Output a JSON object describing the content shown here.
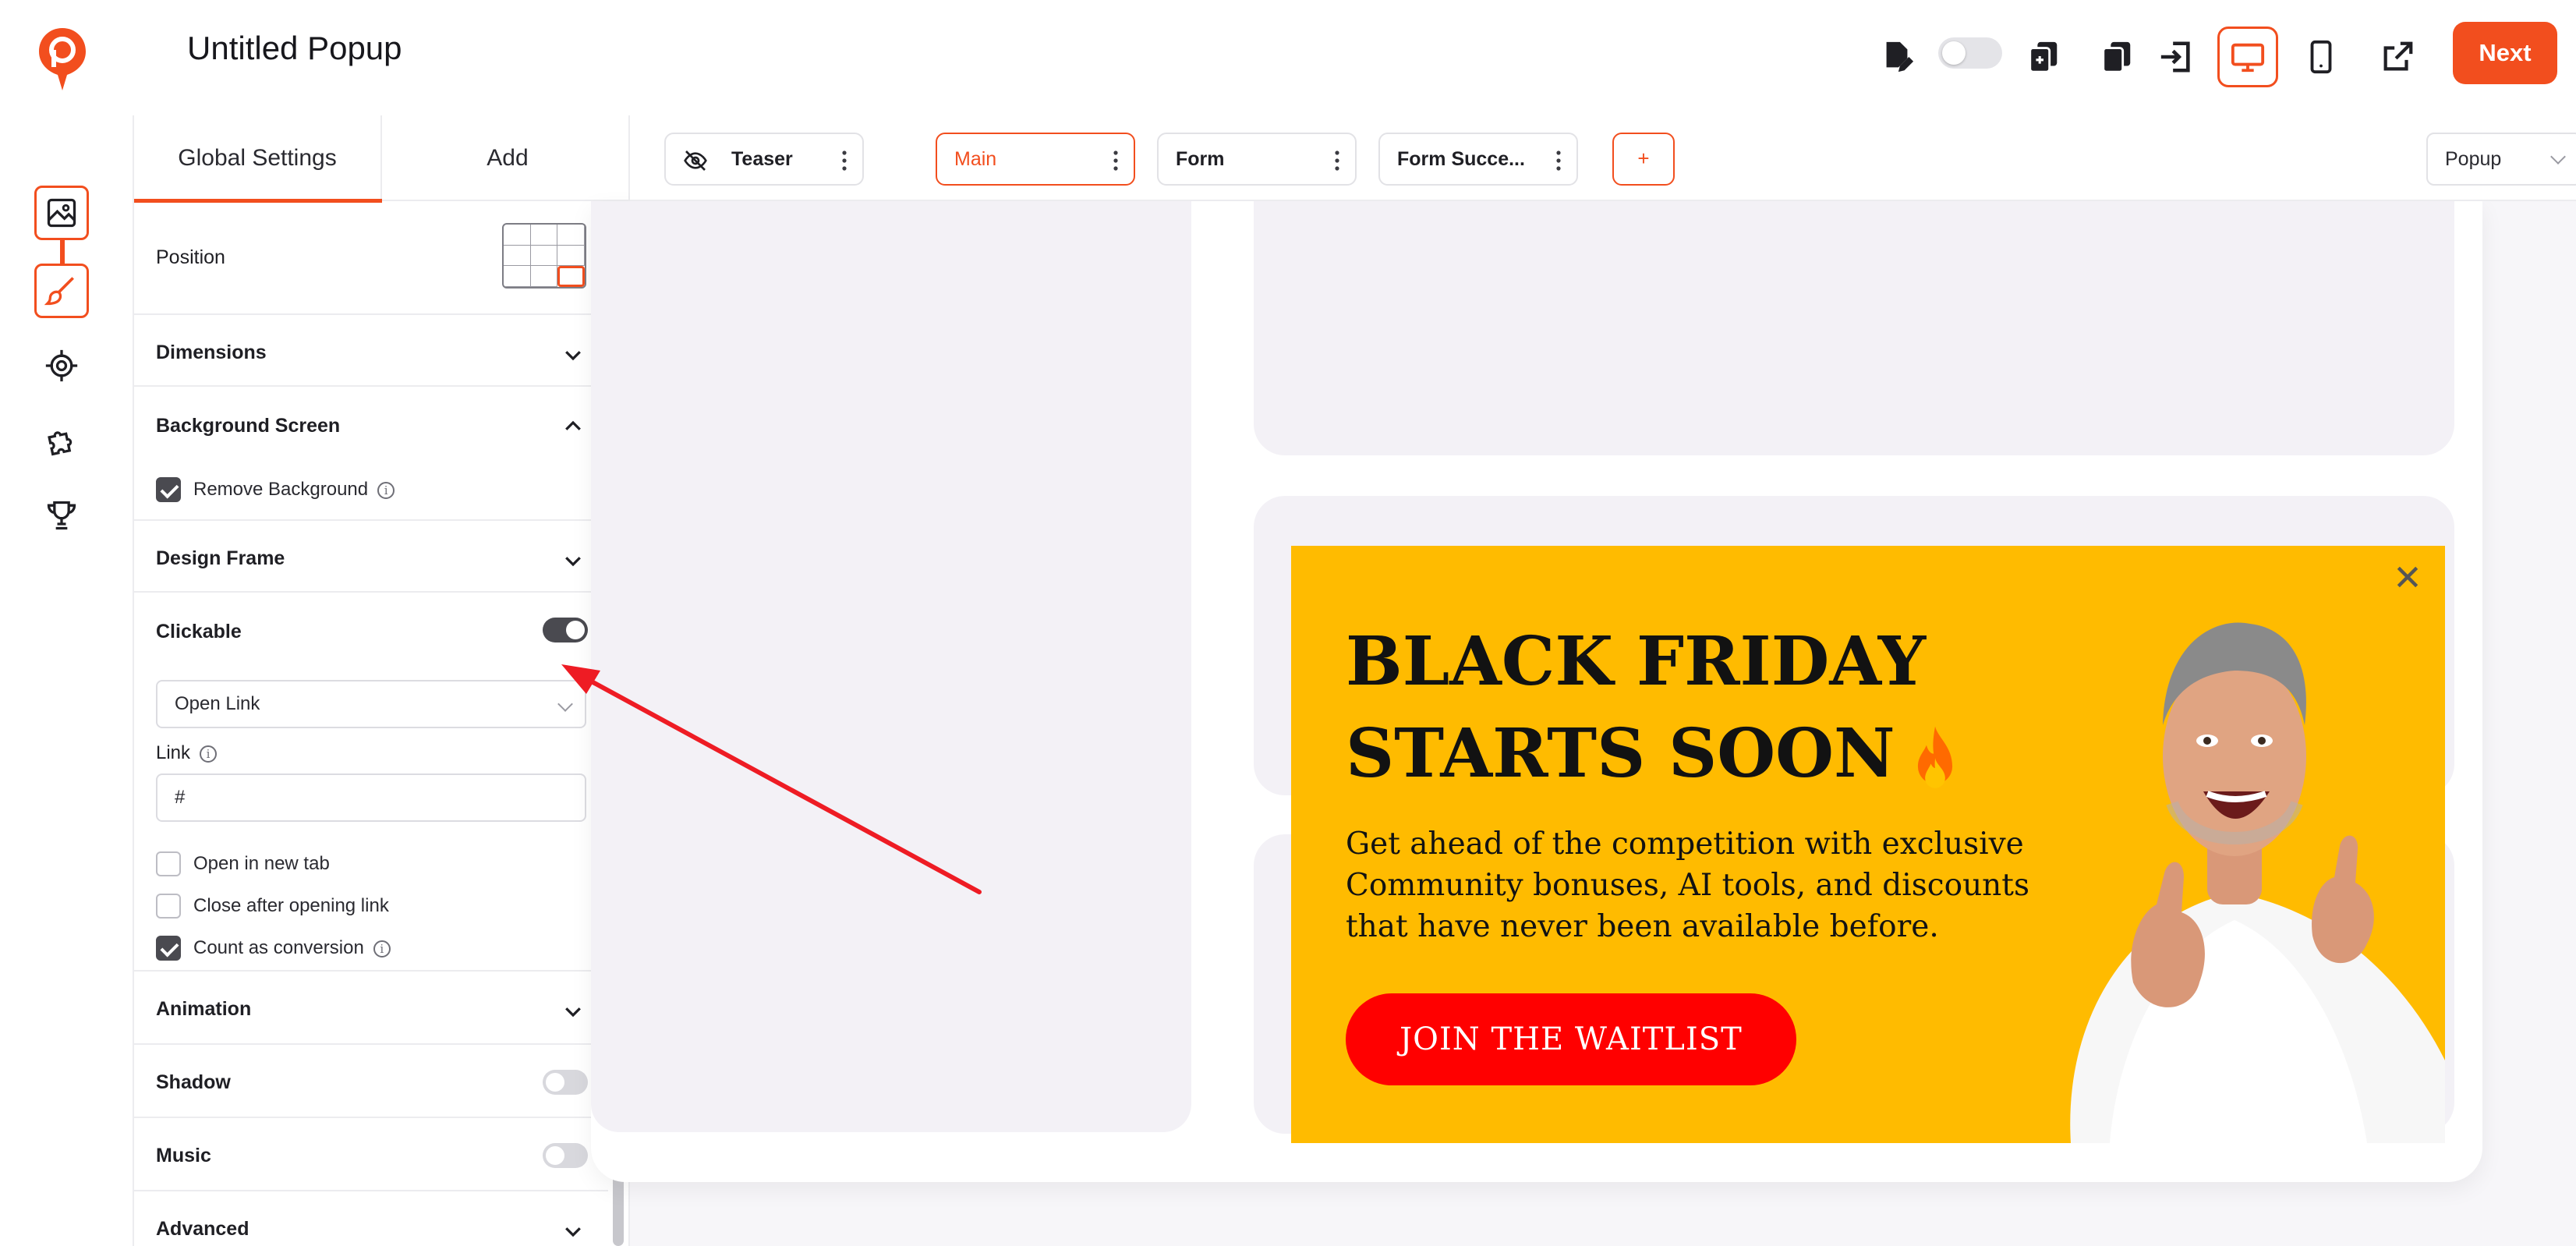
{
  "app": {
    "title": "Untitled Popup",
    "next_label": "Next",
    "accent": "#f24e1e"
  },
  "toolbar": {
    "icons": [
      "edit-document-icon",
      "toggle",
      "duplicate-icon",
      "copy-icon",
      "import-icon",
      "desktop-icon",
      "mobile-icon",
      "external-link-icon"
    ],
    "active": "desktop-icon"
  },
  "rail": {
    "items": [
      "image-icon",
      "brush-icon",
      "target-icon",
      "puzzle-icon",
      "trophy-icon"
    ]
  },
  "panel": {
    "tabs": [
      "Global Settings",
      "Add"
    ],
    "position_label": "Position",
    "dimensions_label": "Dimensions",
    "background_screen_label": "Background Screen",
    "remove_background_label": "Remove Background",
    "design_frame_label": "Design Frame",
    "clickable_label": "Clickable",
    "clickable_on": true,
    "action_select": "Open Link",
    "link_label": "Link",
    "link_value": "#",
    "open_new_tab_label": "Open in new tab",
    "close_after_label": "Close after opening link",
    "count_conversion_label": "Count as conversion",
    "animation_label": "Animation",
    "shadow_label": "Shadow",
    "music_label": "Music",
    "advanced_label": "Advanced"
  },
  "screens": {
    "tabs": [
      {
        "label": "Teaser",
        "hidden": true
      },
      {
        "label": "Main",
        "active": true
      },
      {
        "label": "Form"
      },
      {
        "label": "Form Succe..."
      }
    ],
    "add_label": "+",
    "type_select": "Popup"
  },
  "popup": {
    "title_line1": "BLACK FRIDAY",
    "title_line2": "STARTS SOON",
    "body": "Get ahead of the competition with exclusive Community bonuses, AI tools, and discounts that have never been available before.",
    "cta": "JOIN THE WAITLIST",
    "background": "#ffbb00",
    "cta_color": "#ff0000"
  }
}
